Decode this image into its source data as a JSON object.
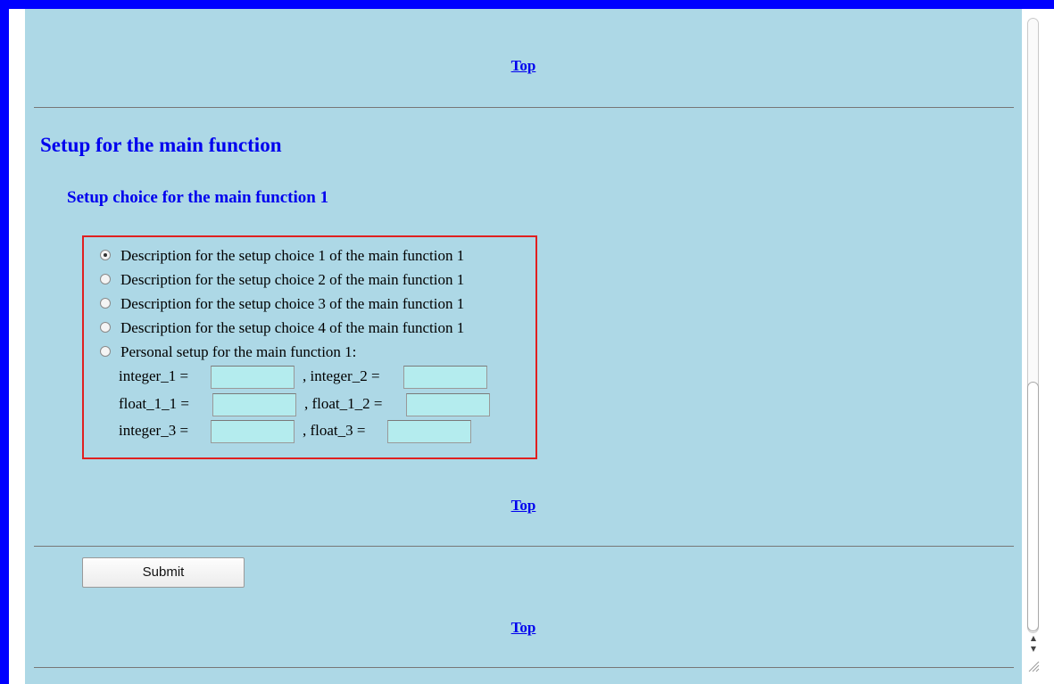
{
  "top_link": "Top",
  "main_heading": "Setup for the main function",
  "sub_heading": "Setup choice for the main function 1",
  "choices": [
    {
      "label": "Description for the setup choice 1 of the main function 1",
      "checked": true
    },
    {
      "label": "Description for the setup choice 2 of the main function 1",
      "checked": false
    },
    {
      "label": "Description for the setup choice 3 of the main function 1",
      "checked": false
    },
    {
      "label": "Description for the setup choice 4 of the main function 1",
      "checked": false
    },
    {
      "label": "Personal setup for the main function 1:",
      "checked": false
    }
  ],
  "params": {
    "row1": {
      "a": "integer_1 =",
      "b": ", integer_2 ="
    },
    "row2": {
      "a": "float_1_1 =",
      "b": ", float_1_2 ="
    },
    "row3": {
      "a": "integer_3 =",
      "b": ", float_3 ="
    }
  },
  "fields": {
    "integer_1": "",
    "integer_2": "",
    "float_1_1": "",
    "float_1_2": "",
    "integer_3": "",
    "float_3": ""
  },
  "submit_label": "Submit",
  "colors": {
    "frame": "#0000ff",
    "background": "#add8e6",
    "heading": "#0000ee",
    "box_border": "#e02020",
    "field_bg": "#b4ecee"
  },
  "icons": {
    "scroll_up": "scroll-up-arrow-icon",
    "scroll_down": "scroll-down-arrow-icon",
    "resize": "resize-grip-icon"
  }
}
